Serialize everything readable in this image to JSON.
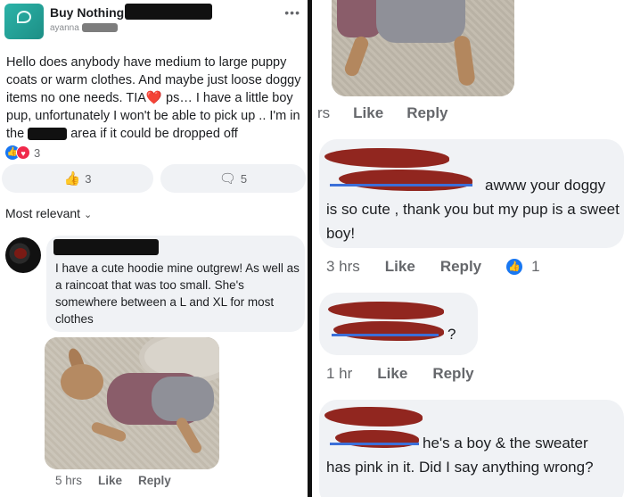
{
  "left": {
    "group_name": "Buy Nothing",
    "author_sub": "ayanna  · ar",
    "post_text_before_heart": "Hello does anybody have medium to large puppy coats or warm clothes. And maybe just loose doggy items no one needs. TIA",
    "heart": "❤️",
    "post_text_after_heart": " ps… I have a little boy pup, unfortunately I won't be able to pick up .. I'm in the ",
    "post_text_end": " area if it could be dropped off",
    "reaction_count": "3",
    "like_count": "3",
    "comment_count": "5",
    "sort_label": "Most relevant",
    "comment": {
      "text": "I have a cute hoodie mine outgrew! As well as a raincoat that was too small. She's somewhere between a L and XL for most clothes",
      "time": "5 hrs",
      "like": "Like",
      "reply": "Reply"
    }
  },
  "right": {
    "top_meta": {
      "time": "rs",
      "like": "Like",
      "reply": "Reply"
    },
    "comment1": {
      "text_line1": "awww your doggy",
      "text_rest": "is so cute , thank you but my pup is a sweet boy!",
      "time": "3 hrs",
      "like": "Like",
      "reply": "Reply",
      "reaction_count": "1"
    },
    "comment2": {
      "text": "?",
      "time": "1 hr",
      "like": "Like",
      "reply": "Reply"
    },
    "comment3": {
      "text_line1": "he's a boy & the sweater",
      "text_rest": "has pink in it. Did I say anything wrong?"
    }
  },
  "colors": {
    "accent": "#1877f2",
    "bubble": "#f0f2f5",
    "redaction": "#8b1a13"
  }
}
